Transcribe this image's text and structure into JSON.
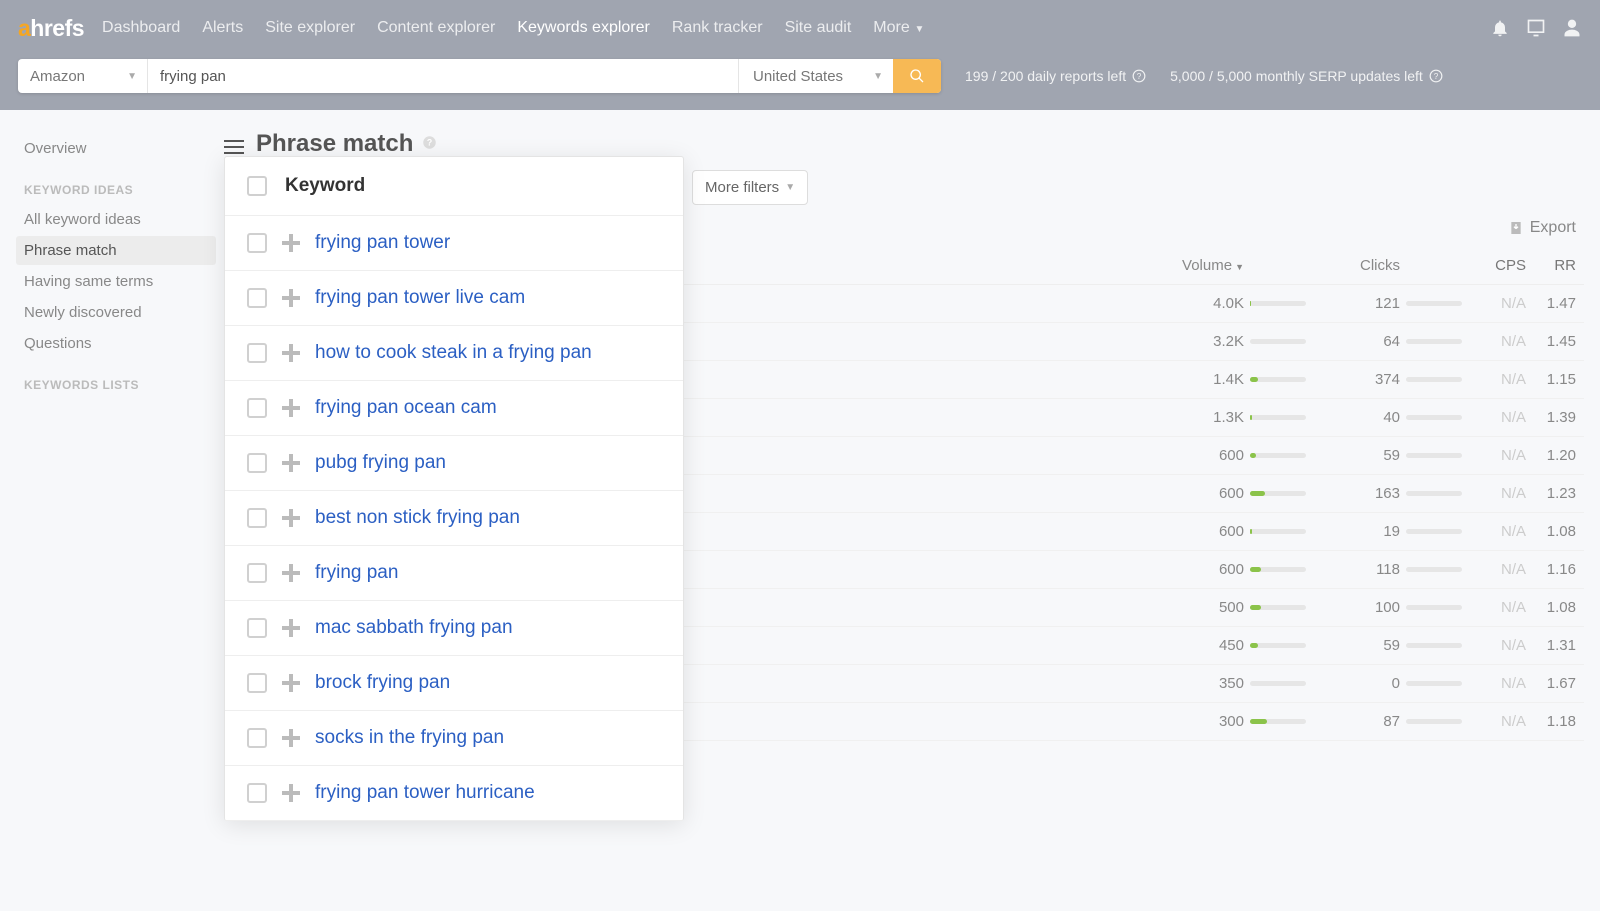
{
  "brand": {
    "a": "a",
    "rest": "hrefs"
  },
  "nav": {
    "items": [
      {
        "label": "Dashboard",
        "active": false
      },
      {
        "label": "Alerts",
        "active": false
      },
      {
        "label": "Site explorer",
        "active": false
      },
      {
        "label": "Content explorer",
        "active": false
      },
      {
        "label": "Keywords explorer",
        "active": true
      },
      {
        "label": "Rank tracker",
        "active": false
      },
      {
        "label": "Site audit",
        "active": false
      },
      {
        "label": "More",
        "active": false,
        "caret": true
      }
    ]
  },
  "search": {
    "engine": "Amazon",
    "query": "frying pan",
    "country": "United States"
  },
  "usage": {
    "daily": "199 / 200 daily reports left",
    "monthly": "5,000 / 5,000 monthly SERP updates left"
  },
  "sidebar": {
    "top": [
      {
        "label": "Overview"
      }
    ],
    "heading1": "KEYWORD IDEAS",
    "ideas": [
      {
        "label": "All keyword ideas",
        "active": false
      },
      {
        "label": "Phrase match",
        "active": true
      },
      {
        "label": "Having same terms",
        "active": false
      },
      {
        "label": "Newly discovered",
        "active": false
      },
      {
        "label": "Questions",
        "active": false
      }
    ],
    "heading2": "KEYWORDS LISTS"
  },
  "page": {
    "title": "Phrase match",
    "more_filters": "More filters",
    "export": "Export"
  },
  "columns": {
    "volume": "Volume",
    "clicks": "Clicks",
    "cps": "CPS",
    "rr": "RR"
  },
  "popover": {
    "header": "Keyword",
    "keywords": [
      "frying pan tower",
      "frying pan tower live cam",
      "how to cook steak in a frying pan",
      "frying pan ocean cam",
      "pubg frying pan",
      "best non stick frying pan",
      "frying pan",
      "mac sabbath frying pan",
      "brock frying pan",
      "socks in the frying pan",
      "frying pan tower hurricane"
    ]
  },
  "rows": [
    {
      "volume": "4.0K",
      "volbar": 2,
      "clicks": "121",
      "clkbar": 0,
      "cps": "N/A",
      "rr": "1.47"
    },
    {
      "volume": "3.2K",
      "volbar": 0,
      "clicks": "64",
      "clkbar": 0,
      "cps": "N/A",
      "rr": "1.45"
    },
    {
      "volume": "1.4K",
      "volbar": 14,
      "clicks": "374",
      "clkbar": 0,
      "cps": "N/A",
      "rr": "1.15"
    },
    {
      "volume": "1.3K",
      "volbar": 4,
      "clicks": "40",
      "clkbar": 0,
      "cps": "N/A",
      "rr": "1.39"
    },
    {
      "volume": "600",
      "volbar": 10,
      "clicks": "59",
      "clkbar": 0,
      "cps": "N/A",
      "rr": "1.20"
    },
    {
      "volume": "600",
      "volbar": 26,
      "clicks": "163",
      "clkbar": 0,
      "cps": "N/A",
      "rr": "1.23"
    },
    {
      "volume": "600",
      "volbar": 4,
      "clicks": "19",
      "clkbar": 0,
      "cps": "N/A",
      "rr": "1.08"
    },
    {
      "volume": "600",
      "volbar": 20,
      "clicks": "118",
      "clkbar": 0,
      "cps": "N/A",
      "rr": "1.16"
    },
    {
      "volume": "500",
      "volbar": 20,
      "clicks": "100",
      "clkbar": 0,
      "cps": "N/A",
      "rr": "1.08"
    },
    {
      "volume": "450",
      "volbar": 14,
      "clicks": "59",
      "clkbar": 0,
      "cps": "N/A",
      "rr": "1.31"
    },
    {
      "volume": "350",
      "volbar": 0,
      "clicks": "0",
      "clkbar": 0,
      "cps": "N/A",
      "rr": "1.67"
    },
    {
      "volume": "300",
      "volbar": 30,
      "clicks": "87",
      "clkbar": 0,
      "cps": "N/A",
      "rr": "1.18"
    }
  ]
}
